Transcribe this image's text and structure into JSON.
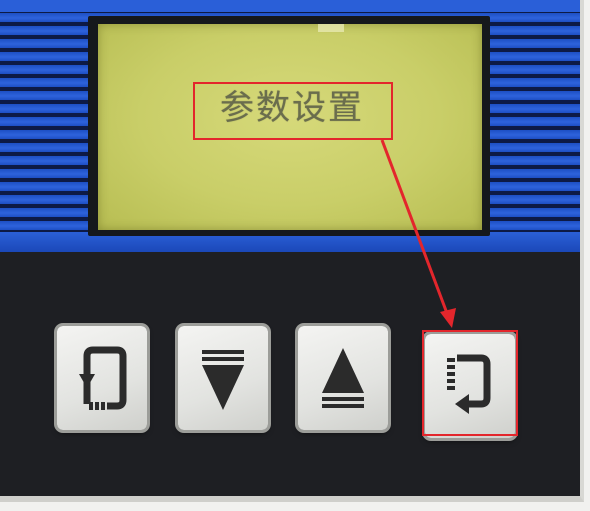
{
  "display": {
    "text": "参数设置"
  },
  "keys": [
    {
      "name": "back",
      "icon": "return-icon"
    },
    {
      "name": "down",
      "icon": "down-triangle-icon"
    },
    {
      "name": "up",
      "icon": "up-triangle-icon"
    },
    {
      "name": "enter",
      "icon": "enter-icon"
    }
  ],
  "annotation": {
    "color": "#e3262c"
  }
}
